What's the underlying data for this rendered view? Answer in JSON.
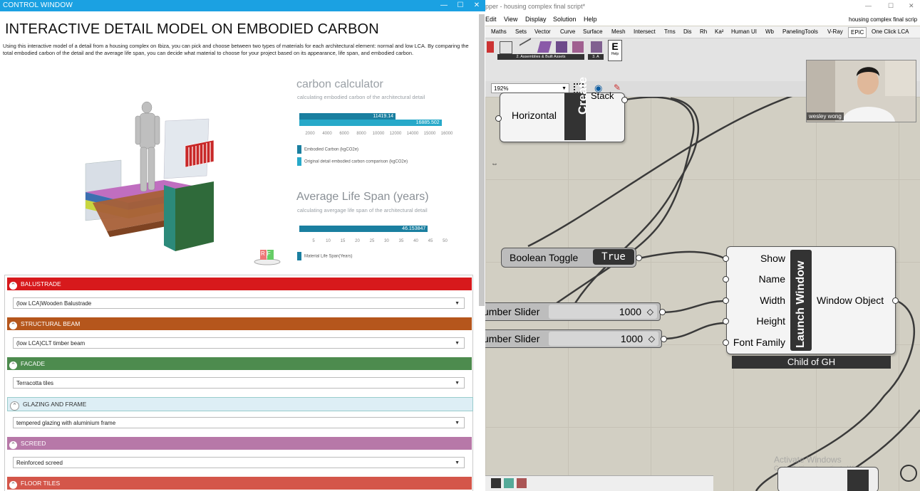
{
  "control_window": {
    "title": "CONTROL WINDOW",
    "heading": "INTERACTIVE DETAIL MODEL ON EMBODIED CARBON",
    "description": "Using this interactive model of a detail from a housing complex on Ibiza, you can pick and choose between two types of materials for each architectural element: normal and low LCA. By comparing the total embodied carbon of the detail and the average life span, you can decide what material to choose for your project based on its appearance, life span, and embodied carbon.",
    "carbon": {
      "title": "carbon calculator",
      "subtitle": "calculating embodied carbon of the architectural detail",
      "embodied_value": 11419.14,
      "original_value": 16885.502,
      "embodied_label": "11419.14",
      "original_label": "16885.502",
      "axis_max": 16000,
      "ticks": [
        "2000",
        "4000",
        "6000",
        "8000",
        "10000",
        "12000",
        "14000",
        "15000",
        "16000"
      ],
      "legend_embodied": "Embodied Carbon (kgCO2e)",
      "legend_original": "Original detail embodied carbon comparison (kgCO2e)",
      "color_embodied": "#1a7fa0",
      "color_original": "#27a9c9"
    },
    "lifespan": {
      "title": "Average Life Span (years)",
      "subtitle": "calculating avergage life span of the architectural detail",
      "value": 46.153847,
      "value_label": "46.153847",
      "axis_max": 50,
      "ticks": [
        "5",
        "10",
        "15",
        "20",
        "25",
        "30",
        "35",
        "40",
        "45",
        "50"
      ],
      "legend": "Material Life Span(Years)",
      "color": "#1a7fa0"
    },
    "categories": [
      {
        "label": "BALUSTRADE",
        "value": "(low LCA)Wooden Balustrade",
        "color": "#d7191c"
      },
      {
        "label": "STRUCTURAL BEAM",
        "value": "(low LCA)CLT timber beam",
        "color": "#b5561c"
      },
      {
        "label": "FACADE",
        "value": "Terracotta tiles",
        "color": "#4d8b4e"
      },
      {
        "label": "GLAZING AND FRAME",
        "value": "tempered glazing with aluminium frame",
        "color": "#ddeef5"
      },
      {
        "label": "SCREED",
        "value": "Reinforced screed",
        "color": "#b778a8"
      },
      {
        "label": "FLOOR TILES",
        "value": "",
        "color": "#d4564a"
      }
    ],
    "logo_text": "RF"
  },
  "grasshopper": {
    "title": "pper - housing complex final script*",
    "title_right": "housing complex final scrip",
    "menu": [
      "Edit",
      "View",
      "Display",
      "Solution",
      "Help"
    ],
    "tabs": [
      "Maths",
      "Sets",
      "Vector",
      "Curve",
      "Surface",
      "Mesh",
      "Intersect",
      "Trns",
      "Dis",
      "Rh",
      "Ka²",
      "Human UI",
      "Wb",
      "PanelingTools",
      "V-Ray",
      "EPiC",
      "One Click LCA"
    ],
    "toolbar_groups": [
      "2. Assemblies & Built Assets",
      "3. A"
    ],
    "toolbar_help": "Help",
    "zoom": "192%",
    "nodes": {
      "create_input": "Horizontal",
      "create_label": "Create",
      "create_output": "Stack",
      "boolean_toggle_label": "Boolean Toggle",
      "boolean_toggle_value": "True",
      "slider1_label": "umber Slider",
      "slider1_value": "1000",
      "slider2_label": "umber Slider",
      "slider2_value": "1000",
      "launch_label": "Launch Window",
      "launch_inputs": [
        "Show",
        "Name",
        "Width",
        "Height",
        "Font Family"
      ],
      "launch_output": "Window Object",
      "launch_footer": "Child of GH"
    },
    "webcam_name": "wesley wong",
    "watermark_1": "Activate Windows",
    "watermark_2": "Go to Settings to activate Windows."
  }
}
